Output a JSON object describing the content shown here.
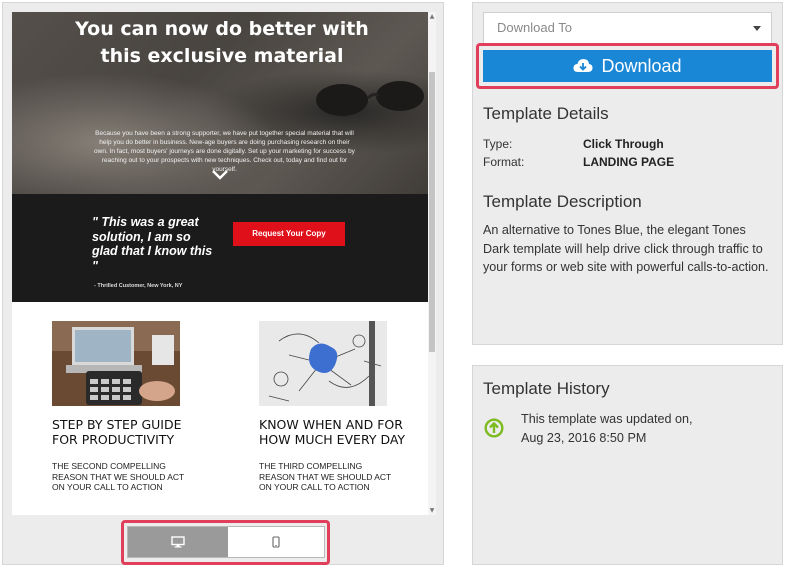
{
  "preview": {
    "hero": {
      "title": "You can now do better with this exclusive material",
      "body": "Because you have been a strong supporter, we have put together special material that will help you do better in business. New-age buyers are doing purchasing research on their own. In fact, most buyers' journeys are done digitally. Set up your marketing for success by reaching out to your prospects with new techniques. Check out, today and find out for yourself."
    },
    "testimonial": {
      "quote": "\" This was a great solution, I am so glad that I know this \"",
      "author": "- Thrilled Customer, New York, NY",
      "cta": "Request Your Copy",
      "cta_color": "#e0101b"
    },
    "features": [
      {
        "title": "STEP BY STEP GUIDE FOR PRODUCTIVITY",
        "text": "THE SECOND COMPELLING REASON THAT WE SHOULD ACT ON YOUR CALL TO ACTION"
      },
      {
        "title": "KNOW WHEN AND FOR HOW MUCH EVERY DAY",
        "text": "THE THIRD COMPELLING REASON THAT WE SHOULD ACT ON YOUR CALL TO ACTION"
      }
    ],
    "device_toggle": {
      "selected": "desktop",
      "options": [
        "desktop-icon",
        "mobile-icon"
      ]
    }
  },
  "details": {
    "download_to_placeholder": "Download To",
    "download_label": "Download",
    "download_color": "#1a86d6",
    "highlight_color": "#e03e5a",
    "template_details_title": "Template Details",
    "type_label": "Type:",
    "type_value": "Click Through",
    "format_label": "Format:",
    "format_value": "LANDING PAGE",
    "description_title": "Template Description",
    "description": "An alternative to Tones Blue, the elegant Tones Dark template will help drive click through traffic to your forms or web site with powerful calls-to-action."
  },
  "history": {
    "title": "Template History",
    "line1": "This template was updated on,",
    "line2": "Aug 23, 2016 8:50 PM",
    "icon_color": "#7dbb1f"
  }
}
